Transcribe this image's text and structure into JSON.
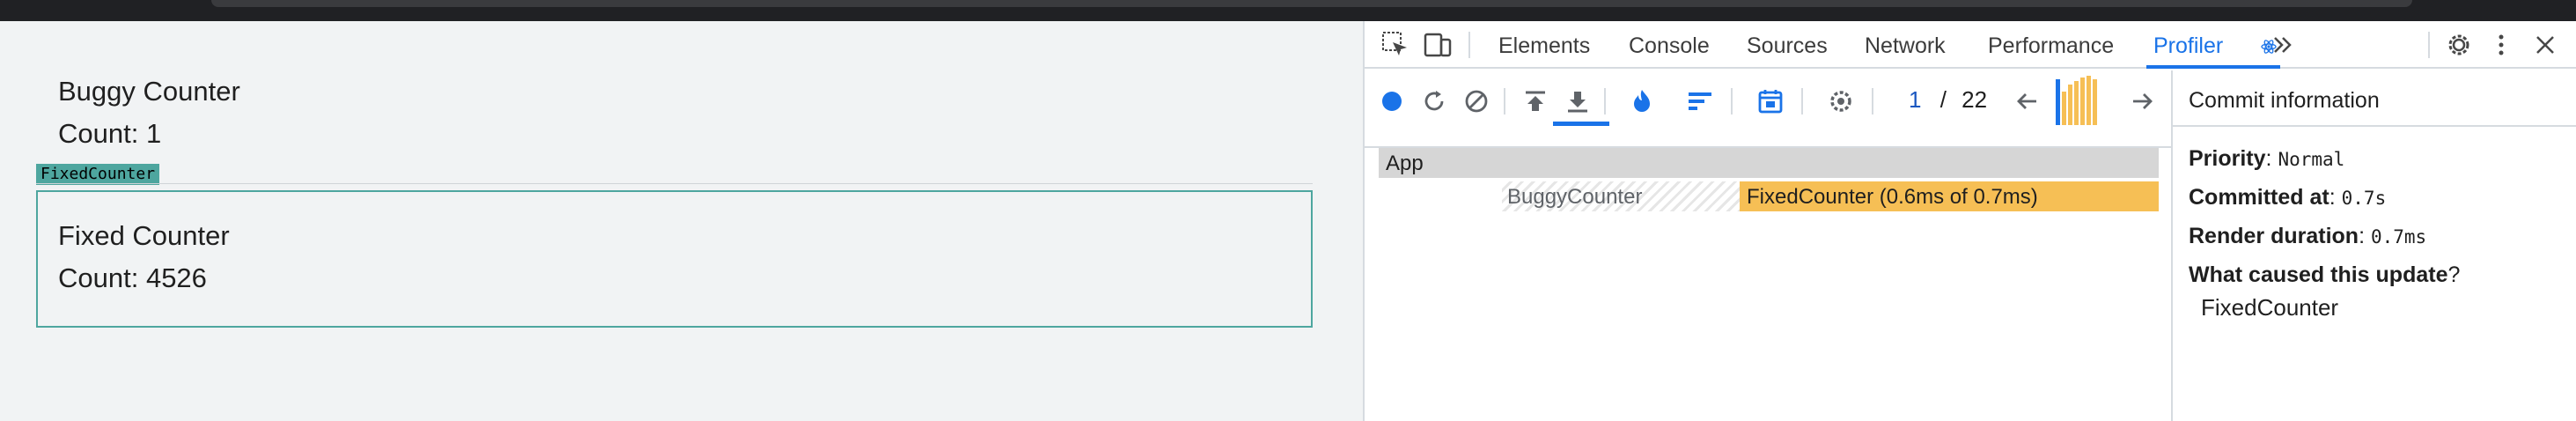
{
  "app": {
    "buggy_title": "Buggy Counter",
    "buggy_count": "Count: 1",
    "highlight_label": "FixedCounter",
    "fixed_title": "Fixed Counter",
    "fixed_count": "Count: 4526"
  },
  "devtools": {
    "tabs": [
      {
        "label": "Elements"
      },
      {
        "label": "Console"
      },
      {
        "label": "Sources"
      },
      {
        "label": "Network"
      },
      {
        "label": "Performance"
      },
      {
        "label": "Profiler"
      }
    ],
    "active_tab": "Profiler",
    "icons": {
      "inspect": "inspect-element-icon",
      "device": "device-toolbar-icon",
      "more_tabs": "more-tabs-icon",
      "settings": "settings-gear-icon",
      "kebab": "kebab-menu-icon",
      "close": "close-icon"
    },
    "profiler": {
      "commit_current": "1",
      "commit_sep": "/",
      "commit_total": "22",
      "toolbar_icons": [
        "record-icon",
        "reload-icon",
        "clear-icon",
        "upload-icon",
        "download-icon",
        "flame-chart-icon",
        "ranked-chart-icon",
        "timeline-icon",
        "settings-icon"
      ],
      "flame": {
        "root": "App",
        "buggy": "BuggyCounter",
        "fixed": "FixedCounter (0.6ms of 0.7ms)"
      },
      "commit_info": {
        "title": "Commit information",
        "priority_label": "Priority",
        "priority_value": "Normal",
        "committed_label": "Committed at",
        "committed_value": "0.7s",
        "render_label": "Render duration",
        "render_value": "0.7ms",
        "cause_label": "What caused this update",
        "cause_value": "FixedCounter"
      }
    },
    "colors": {
      "accent": "#1a73e8",
      "highlight": "#4ea69f",
      "commit_bar": "#f6bf55"
    }
  }
}
